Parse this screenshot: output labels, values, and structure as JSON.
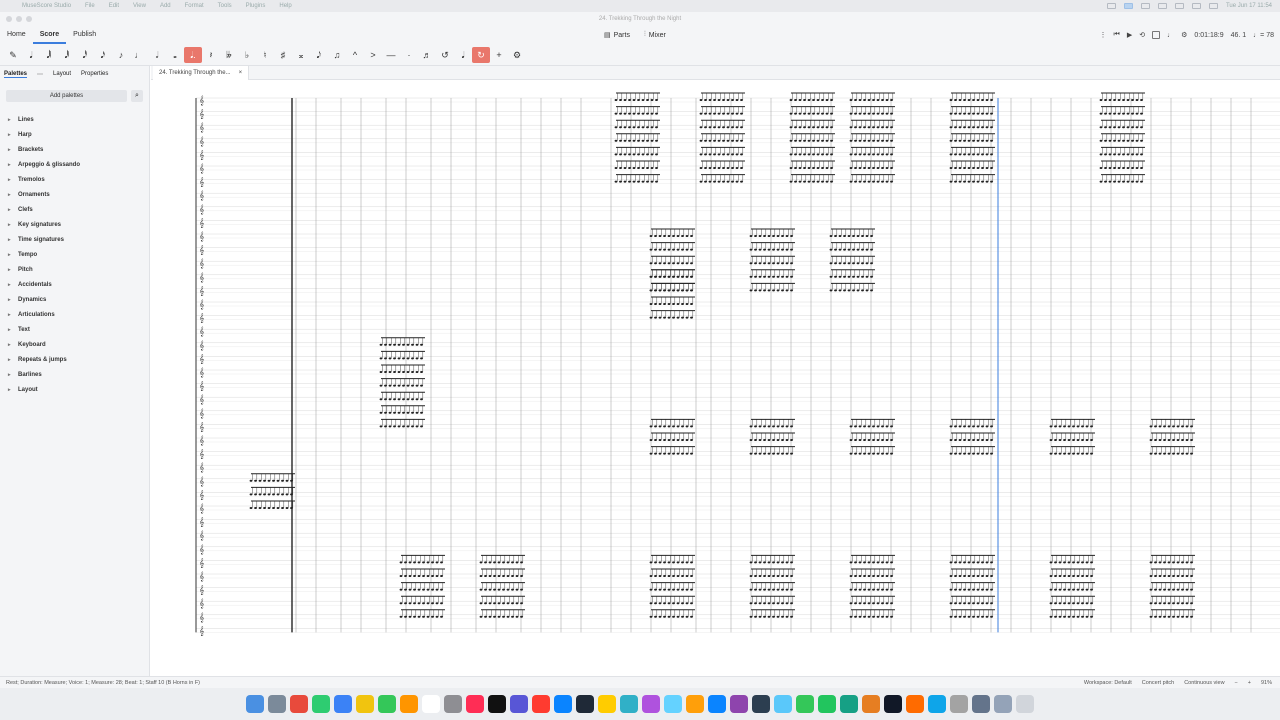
{
  "menubar": {
    "items": [
      "MuseScore Studio",
      "File",
      "Edit",
      "View",
      "Add",
      "Format",
      "Tools",
      "Plugins",
      "Help"
    ],
    "clock": "Tue Jun 17 11:54"
  },
  "window": {
    "title": "24. Trekking Through the Night"
  },
  "top_tabs": {
    "home": "Home",
    "score": "Score",
    "publish": "Publish"
  },
  "center_ctrls": {
    "parts": "Parts",
    "mixer": "Mixer"
  },
  "playback": {
    "time": "0:01:18:9",
    "position": "46. 1",
    "tempo": "♩= 78"
  },
  "toolbar": {
    "buttons": [
      "✎",
      "𝅘𝅥",
      "𝅘𝅥𝅲",
      "𝅘𝅥𝅱",
      "𝅘𝅥𝅰",
      "𝅘𝅥𝅯",
      "♪",
      "♩",
      "𝅗𝅥",
      "𝅝",
      "𝅘𝅥.",
      "𝄽",
      "𝄫",
      "♭",
      "♮",
      "♯",
      "𝄪",
      "𝅘𝅥𝅮",
      "♫",
      "^",
      ">",
      "—",
      "·",
      "♬",
      "↺",
      "𝅘𝅥",
      "↻",
      "+",
      "⚙"
    ]
  },
  "sidebar": {
    "tabs": [
      "Palettes",
      "Layout",
      "Properties"
    ],
    "add_palettes": "Add palettes",
    "palettes": [
      "Lines",
      "Harp",
      "Brackets",
      "Arpeggio & glissando",
      "Tremolos",
      "Ornaments",
      "Clefs",
      "Key signatures",
      "Time signatures",
      "Tempo",
      "Pitch",
      "Accidentals",
      "Dynamics",
      "Articulations",
      "Text",
      "Keyboard",
      "Repeats & jumps",
      "Barlines",
      "Layout"
    ]
  },
  "document": {
    "tab_label": "24. Trekking Through the..."
  },
  "status": {
    "text": "Rest; Duration: Measure; Voice: 1; Measure: 28; Beat: 1; Staff 10 (B Horns in F)",
    "workspace": "Workspace: Default",
    "concert_pitch": "Concert pitch",
    "view_mode": "Continuous view",
    "zoom": "91%"
  },
  "colors": {
    "accent": "#3b7ddd",
    "active_tool": "#e9776b",
    "panel": "#f4f5f7"
  }
}
